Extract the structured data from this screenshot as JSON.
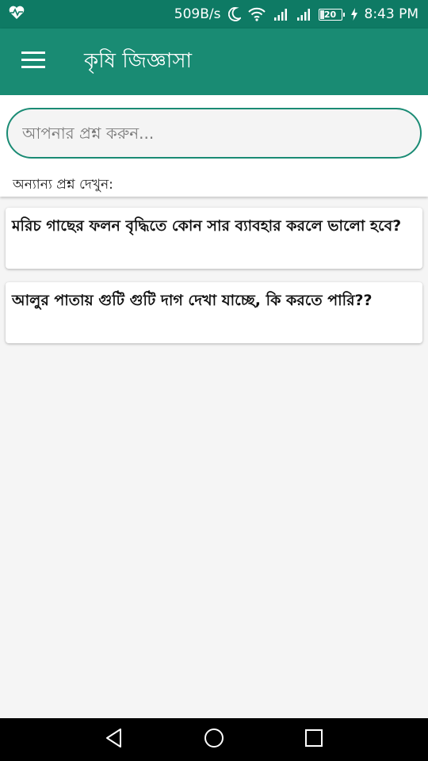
{
  "status_bar": {
    "net_speed": "509B/s",
    "battery": "20",
    "time": "8:43 PM",
    "icons": [
      "health-icon",
      "moon-icon",
      "wifi-icon",
      "signal-icon",
      "signal-icon",
      "battery-icon",
      "charging-icon"
    ]
  },
  "app_bar": {
    "title": "কৃষি জিজ্ঞাসা",
    "menu_icon": "hamburger-menu-icon"
  },
  "search": {
    "placeholder": "আপনার প্রশ্ন করুন...",
    "section_label": "অন্যান্য প্রশ্ন দেখুন:"
  },
  "questions": [
    {
      "text": "মরিচ গাছের ফলন বৃদ্ধিতে কোন সার ব্যাবহার করলে ভালো হবে?"
    },
    {
      "text": "আলুর পাতায় গুটি গুটি দাগ দেখা যাচ্ছে, কি করতে পারি??"
    }
  ],
  "nav_bar": {
    "icons": [
      "back-icon",
      "home-icon",
      "recents-icon"
    ]
  },
  "colors": {
    "status_bar": "#0e7a64",
    "app_bar": "#198b73",
    "accent": "#1a8b74",
    "background": "#f5f5f5"
  }
}
